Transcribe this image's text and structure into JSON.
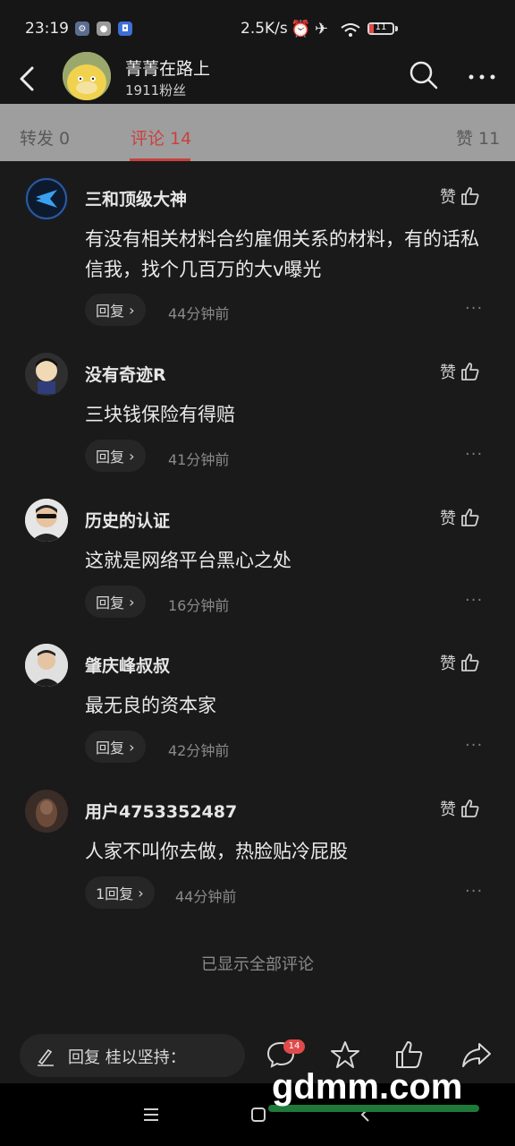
{
  "status_bar": {
    "time": "23:19",
    "net_speed": "2.5K/s",
    "battery": "11"
  },
  "header": {
    "title": "菁菁在路上",
    "fans": "1911粉丝"
  },
  "tabs": {
    "repost": "转发 0",
    "comments": "评论 14",
    "likes": "赞 11"
  },
  "comments": [
    {
      "user": "三和顶级大神",
      "text": "有没有相关材料合约雇佣关系的材料，有的话私信我，找个几百万的大v曝光",
      "reply": "回复",
      "time": "44分钟前",
      "like": "赞"
    },
    {
      "user": "没有奇迹R",
      "text": "三块钱保险有得赔",
      "reply": "回复",
      "time": "41分钟前",
      "like": "赞"
    },
    {
      "user": "历史的认证",
      "text": "这就是网络平台黑心之处",
      "reply": "回复",
      "time": "16分钟前",
      "like": "赞"
    },
    {
      "user": "肇庆峰叔叔",
      "text": "最无良的资本家",
      "reply": "回复",
      "time": "42分钟前",
      "like": "赞"
    },
    {
      "user": "用户4753352487",
      "text": "人家不叫你去做，热脸贴冷屁股",
      "reply": "1回复",
      "time": "44分钟前",
      "like": "赞"
    }
  ],
  "end_note": "已显示全部评论",
  "bottom_bar": {
    "reply_placeholder": "回复 桂以坚持：",
    "comment_badge": "14"
  },
  "watermark": "gdmm.com"
}
